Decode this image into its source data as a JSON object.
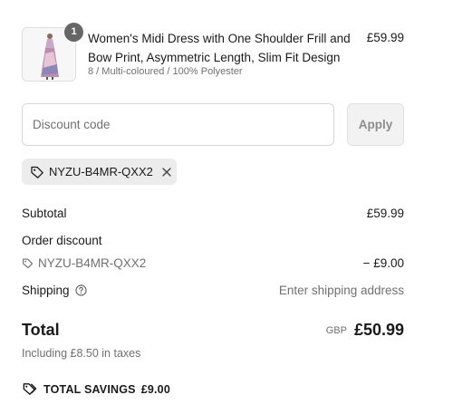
{
  "product": {
    "quantity": "1",
    "name": "Women's Midi Dress with One Shoulder Frill and Bow Print, Asymmetric Length, Slim Fit Design",
    "variant": "8 / Multi-coloured / 100% Polyester",
    "price": "£59.99",
    "image_icon": "dress-thumbnail"
  },
  "discount": {
    "placeholder": "Discount code",
    "apply_label": "Apply",
    "applied_code": "NYZU-B4MR-QXX2"
  },
  "summary": {
    "subtotal_label": "Subtotal",
    "subtotal_value": "£59.99",
    "order_discount_label": "Order discount",
    "discount_code": "NYZU-B4MR-QXX2",
    "discount_value": "− £9.00",
    "shipping_label": "Shipping",
    "shipping_value": "Enter shipping address",
    "total_label": "Total",
    "currency": "GBP",
    "total_value": "£50.99",
    "taxes_note": "Including £8.50 in taxes",
    "savings_label": "TOTAL SAVINGS",
    "savings_value": "£9.00"
  },
  "colors": {
    "text": "#1a1a1a",
    "muted": "#707070",
    "border": "#d6d6d6",
    "chip_bg": "#ececec",
    "badge_bg": "#666666"
  }
}
